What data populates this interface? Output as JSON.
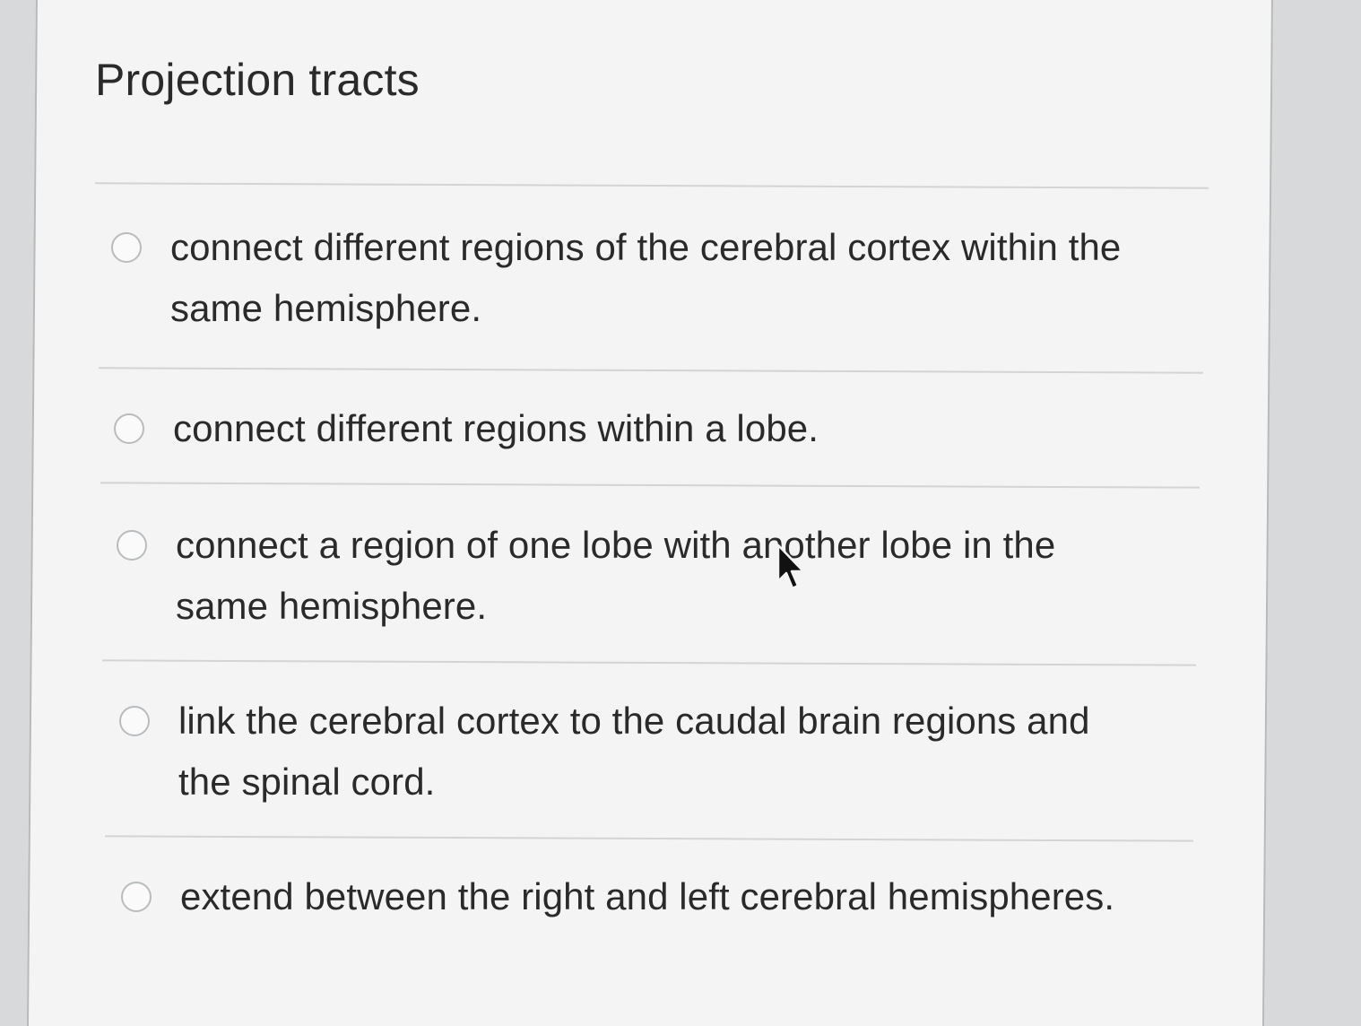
{
  "question": {
    "title": "Projection tracts"
  },
  "options": [
    {
      "label": "connect different regions of the cerebral cortex within the same hemisphere.",
      "selected": false
    },
    {
      "label": "connect different regions within a lobe.",
      "selected": false
    },
    {
      "label": "connect a region of one lobe with another lobe in the same hemisphere.",
      "selected": false
    },
    {
      "label": "link the cerebral cortex to the caudal brain regions and the spinal cord.",
      "selected": false
    },
    {
      "label": "extend between the right and left cerebral hemispheres.",
      "selected": false
    }
  ],
  "colors": {
    "background": "#d7d9da",
    "card": "#f4f4f4",
    "text": "#2a2a2a",
    "divider": "#d2d4d5",
    "radio_border": "#b9bcbe"
  },
  "icons": [
    "radio-icon",
    "mouse-pointer-icon"
  ]
}
